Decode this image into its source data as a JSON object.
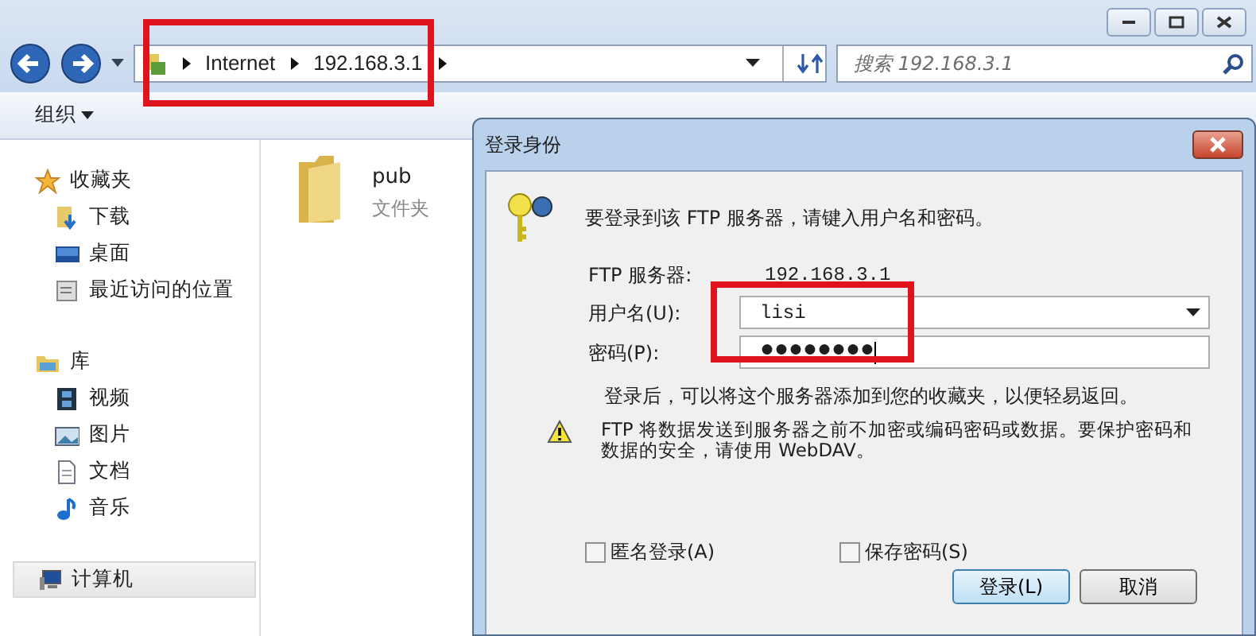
{
  "address_bar": {
    "segments": [
      "Internet",
      "192.168.3.1"
    ],
    "highlighted": true
  },
  "search": {
    "placeholder": "搜索 192.168.3.1"
  },
  "toolbar": {
    "organize": "组织"
  },
  "sidebar": {
    "groups": [
      {
        "label": "收藏夹",
        "kind": "star",
        "selected": false,
        "children": [
          {
            "label": "下载",
            "kind": "download"
          },
          {
            "label": "桌面",
            "kind": "desktop"
          },
          {
            "label": "最近访问的位置",
            "kind": "recent"
          }
        ]
      },
      {
        "label": "库",
        "kind": "library",
        "selected": false,
        "children": [
          {
            "label": "视频",
            "kind": "video"
          },
          {
            "label": "图片",
            "kind": "image"
          },
          {
            "label": "文档",
            "kind": "document"
          },
          {
            "label": "音乐",
            "kind": "music"
          }
        ]
      },
      {
        "label": "计算机",
        "kind": "computer",
        "selected": true
      }
    ]
  },
  "files": [
    {
      "name": "pub",
      "type": "文件夹"
    }
  ],
  "dialog": {
    "title": "登录身份",
    "message": "要登录到该 FTP 服务器，请键入用户名和密码。",
    "fields": [
      {
        "kind": "static",
        "label": "FTP 服务器:",
        "value": "192.168.3.1"
      },
      {
        "kind": "combo",
        "label": "用户名(U):",
        "value": "lisi",
        "highlighted": true
      },
      {
        "kind": "password",
        "label": "密码(P):",
        "value": "●●●●●●●●",
        "highlighted": true
      }
    ],
    "note": "登录后，可以将这个服务器添加到您的收藏夹，以便轻易返回。",
    "warning": "FTP 将数据发送到服务器之前不加密或编码密码或数据。要保护密码和数据的安全，请使用 WebDAV。",
    "checkboxes": [
      {
        "label": "匿名登录(A)",
        "checked": false
      },
      {
        "label": "保存密码(S)",
        "checked": false
      }
    ],
    "buttons": [
      {
        "label": "登录(L)",
        "default": true
      },
      {
        "label": "取消",
        "default": false
      }
    ]
  }
}
